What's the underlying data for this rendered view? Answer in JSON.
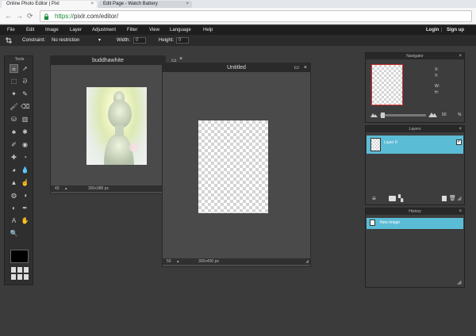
{
  "browser": {
    "tabs": [
      {
        "label": "Online Photo Editor | Pixl",
        "close": "×"
      },
      {
        "label": "Edit Page - Watch Battery",
        "close": "×"
      }
    ],
    "back_glyph": "←",
    "forward_glyph": "→",
    "reload_glyph": "⟳",
    "url_scheme": "https://",
    "url_host": "pixlr.com",
    "url_path": "/editor/"
  },
  "menu": {
    "items": [
      "File",
      "Edit",
      "Image",
      "Layer",
      "Adjustment",
      "Filter",
      "View",
      "Language",
      "Help"
    ],
    "login": "Login",
    "signup": "Sign up"
  },
  "tool_options": {
    "constraint_label": "Constraint:",
    "constraint_value": "No restriction",
    "width_label": "Width:",
    "width_value": "0",
    "height_label": "Height:",
    "height_value": "0"
  },
  "tools": {
    "title": "Tools",
    "icons": [
      "crop-icon",
      "move-icon",
      "marquee-icon",
      "lasso-icon",
      "wand-icon",
      "pencil-icon",
      "brush-icon",
      "eraser-icon",
      "bucket-icon",
      "gradient-icon",
      "clone-icon",
      "color-replace-icon",
      "drawing-icon",
      "red-eye-icon",
      "spot-heal-icon",
      "bloat-icon",
      "pinch-icon",
      "blur-icon",
      "sharpen-icon",
      "smudge-icon",
      "sponge-icon",
      "dodge-icon",
      "burn-icon",
      "eyedropper-icon",
      "type-icon",
      "hand-icon",
      "zoom-icon"
    ]
  },
  "documents": [
    {
      "title": "buddhawhite",
      "zoom": "43",
      "size": "300x388 px"
    },
    {
      "title": "Untitled",
      "zoom": "50",
      "size": "300x400 px"
    }
  ],
  "navigator": {
    "title": "Navigator",
    "x_label": "X:",
    "y_label": "Y:",
    "w_label": "W:",
    "h_label": "H:",
    "zoom_value": "50",
    "zoom_unit": "%"
  },
  "layers": {
    "title": "Layers",
    "items": [
      {
        "name": "Layer 0",
        "checked": true
      }
    ]
  },
  "history": {
    "title": "History",
    "items": [
      "New image"
    ]
  },
  "colors": {
    "accent": "#5bbcd6",
    "navigator_border": "#d0302f"
  }
}
